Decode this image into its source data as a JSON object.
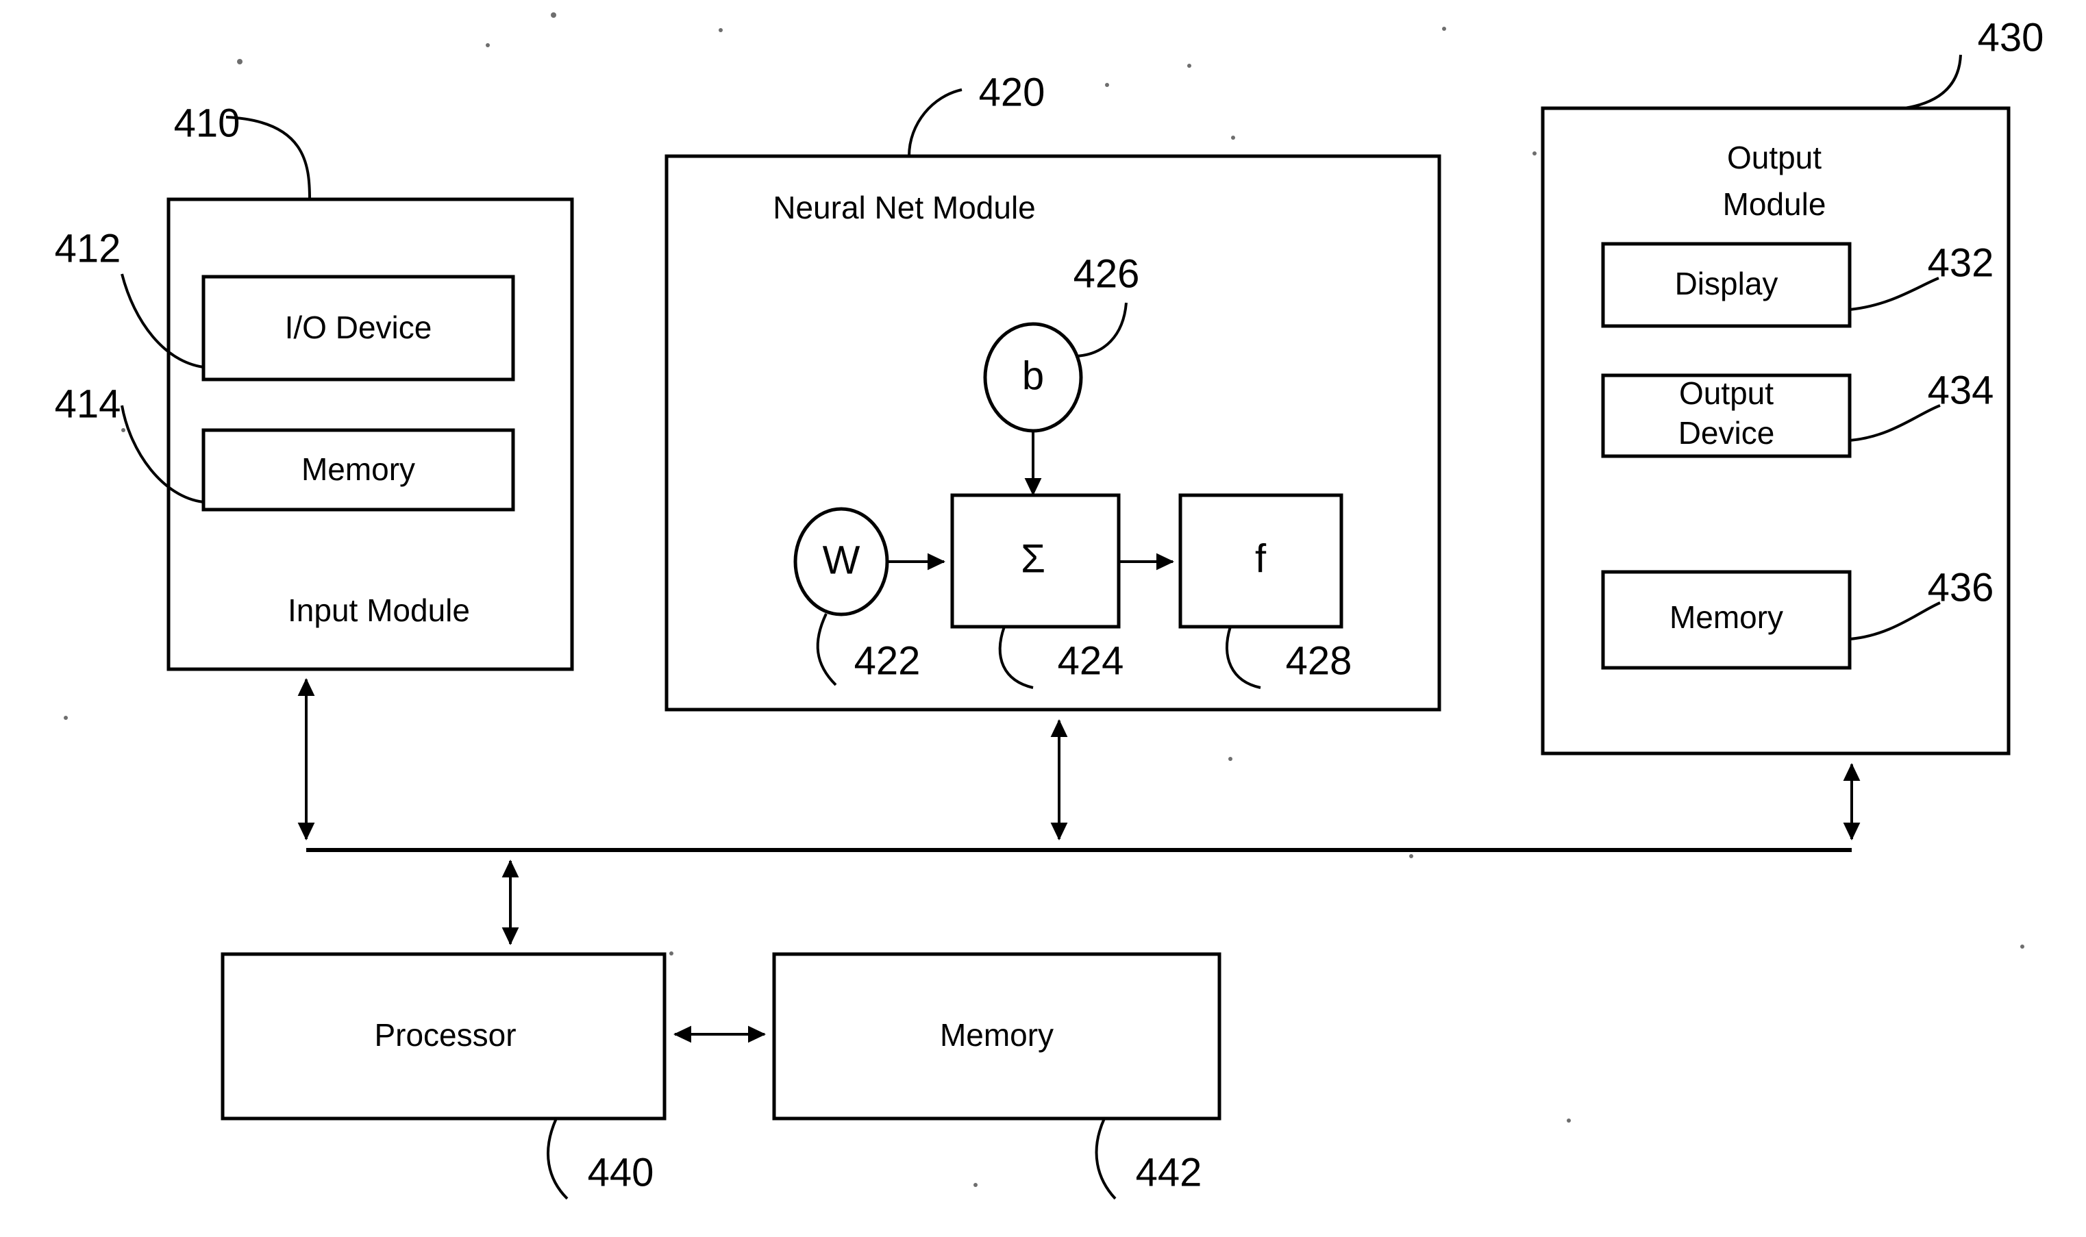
{
  "figure": {
    "kind": "patent-block-diagram",
    "background_color": "#ffffff",
    "line_color": "#000000"
  },
  "input_module": {
    "title": "Input Module",
    "ref": "410",
    "children": [
      {
        "label": "I/O Device",
        "ref": "412"
      },
      {
        "label": "Memory",
        "ref": "414"
      }
    ]
  },
  "neural_net_module": {
    "title": "Neural Net Module",
    "ref": "420",
    "nodes": [
      {
        "label": "W",
        "ref": "422",
        "shape": "ellipse"
      },
      {
        "label": "Σ",
        "ref": "424",
        "shape": "rect"
      },
      {
        "label": "b",
        "ref": "426",
        "shape": "ellipse"
      },
      {
        "label": "f",
        "ref": "428",
        "shape": "rect"
      }
    ]
  },
  "output_module": {
    "title_line1": "Output",
    "title_line2": "Module",
    "ref": "430",
    "children": [
      {
        "label": "Display",
        "ref": "432"
      },
      {
        "label_line1": "Output",
        "label_line2": "Device",
        "ref": "434"
      },
      {
        "label": "Memory",
        "ref": "436"
      }
    ]
  },
  "bottom": {
    "processor": {
      "label": "Processor",
      "ref": "440"
    },
    "memory": {
      "label": "Memory",
      "ref": "442"
    }
  }
}
